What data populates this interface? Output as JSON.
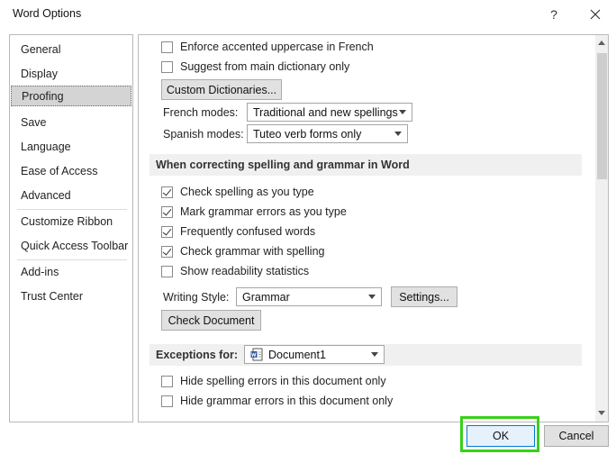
{
  "window": {
    "title": "Word Options",
    "help_label": "?"
  },
  "nav": {
    "items": [
      {
        "label": "General"
      },
      {
        "label": "Display"
      },
      {
        "label": "Proofing"
      },
      {
        "label": "Save"
      },
      {
        "label": "Language"
      },
      {
        "label": "Ease of Access"
      },
      {
        "label": "Advanced"
      },
      {
        "label": "Customize Ribbon"
      },
      {
        "label": "Quick Access Toolbar"
      },
      {
        "label": "Add-ins"
      },
      {
        "label": "Trust Center"
      }
    ],
    "selected": "Proofing"
  },
  "proofing": {
    "enforce_accented": {
      "label": "Enforce accented uppercase in French",
      "checked": false
    },
    "suggest_main": {
      "label": "Suggest from main dictionary only",
      "checked": false
    },
    "custom_dict_button": "Custom Dictionaries...",
    "french_modes": {
      "label": "French modes:",
      "value": "Traditional and new spellings"
    },
    "spanish_modes": {
      "label": "Spanish modes:",
      "value": "Tuteo verb forms only"
    }
  },
  "spelling_section": {
    "header": "When correcting spelling and grammar in Word",
    "options": [
      {
        "label": "Check spelling as you type",
        "checked": true
      },
      {
        "label": "Mark grammar errors as you type",
        "checked": true
      },
      {
        "label": "Frequently confused words",
        "checked": true
      },
      {
        "label": "Check grammar with spelling",
        "checked": true
      },
      {
        "label": "Show readability statistics",
        "checked": false
      }
    ],
    "writing_style": {
      "label": "Writing Style:",
      "value": "Grammar"
    },
    "settings_button": "Settings...",
    "check_document_button": "Check Document"
  },
  "exceptions": {
    "label": "Exceptions for:",
    "document": "Document1",
    "options": [
      {
        "label": "Hide spelling errors in this document only",
        "checked": false
      },
      {
        "label": "Hide grammar errors in this document only",
        "checked": false
      }
    ]
  },
  "footer": {
    "ok_label": "OK",
    "cancel_label": "Cancel"
  },
  "colors": {
    "highlight": "#39d01c",
    "selected_nav_bg": "#d4d4d4",
    "section_bg": "#f0f0f0"
  }
}
